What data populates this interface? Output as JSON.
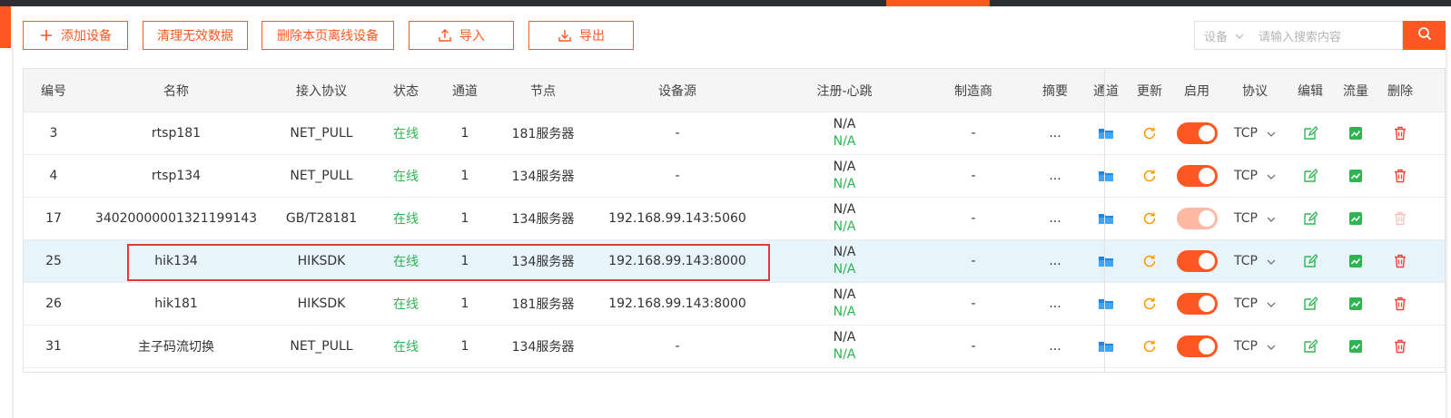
{
  "colors": {
    "accent": "#ff5722",
    "online": "#2db551",
    "blue_icon": "#1e88e5",
    "orange_icon": "#ff9800",
    "delete_icon": "#f44336",
    "highlight_row": "#e8f4fc",
    "annotation_box": "#e53935"
  },
  "toolbar": {
    "add": "添加设备",
    "clean": "清理无效数据",
    "delete_offline": "删除本页离线设备",
    "import": "导入",
    "export": "导出"
  },
  "search": {
    "category": "设备",
    "placeholder": "请输入搜索内容"
  },
  "table": {
    "columns": [
      "编号",
      "名称",
      "接入协议",
      "状态",
      "通道",
      "节点",
      "设备源",
      "注册-心跳",
      "制造商",
      "摘要",
      "通道",
      "更新",
      "启用",
      "协议",
      "编辑",
      "流量",
      "删除"
    ],
    "rows": [
      {
        "id": "3",
        "name": "rtsp181",
        "protocol": "NET_PULL",
        "status": "在线",
        "channel": "1",
        "node": "181服务器",
        "source": "-",
        "reg": "N/A",
        "beat": "N/A",
        "maker": "-",
        "summary": "...",
        "enabled": true,
        "transport": "TCP",
        "highlighted": false
      },
      {
        "id": "4",
        "name": "rtsp134",
        "protocol": "NET_PULL",
        "status": "在线",
        "channel": "1",
        "node": "134服务器",
        "source": "-",
        "reg": "N/A",
        "beat": "N/A",
        "maker": "-",
        "summary": "...",
        "enabled": true,
        "transport": "TCP",
        "highlighted": false
      },
      {
        "id": "17",
        "name": "34020000001321199143",
        "protocol": "GB/T28181",
        "status": "在线",
        "channel": "1",
        "node": "134服务器",
        "source": "192.168.99.143:5060",
        "reg": "N/A",
        "beat": "N/A",
        "maker": "-",
        "summary": "...",
        "enabled": true,
        "transport": "TCP",
        "highlighted": false,
        "disabled_actions": true
      },
      {
        "id": "25",
        "name": "hik134",
        "protocol": "HIKSDK",
        "status": "在线",
        "channel": "1",
        "node": "134服务器",
        "source": "192.168.99.143:8000",
        "reg": "N/A",
        "beat": "N/A",
        "maker": "-",
        "summary": "...",
        "enabled": true,
        "transport": "TCP",
        "highlighted": true
      },
      {
        "id": "26",
        "name": "hik181",
        "protocol": "HIKSDK",
        "status": "在线",
        "channel": "1",
        "node": "181服务器",
        "source": "192.168.99.143:8000",
        "reg": "N/A",
        "beat": "N/A",
        "maker": "-",
        "summary": "...",
        "enabled": true,
        "transport": "TCP",
        "highlighted": false
      },
      {
        "id": "31",
        "name": "主子码流切换",
        "protocol": "NET_PULL",
        "status": "在线",
        "channel": "1",
        "node": "134服务器",
        "source": "-",
        "reg": "N/A",
        "beat": "N/A",
        "maker": "-",
        "summary": "...",
        "enabled": true,
        "transport": "TCP",
        "highlighted": false
      }
    ]
  }
}
